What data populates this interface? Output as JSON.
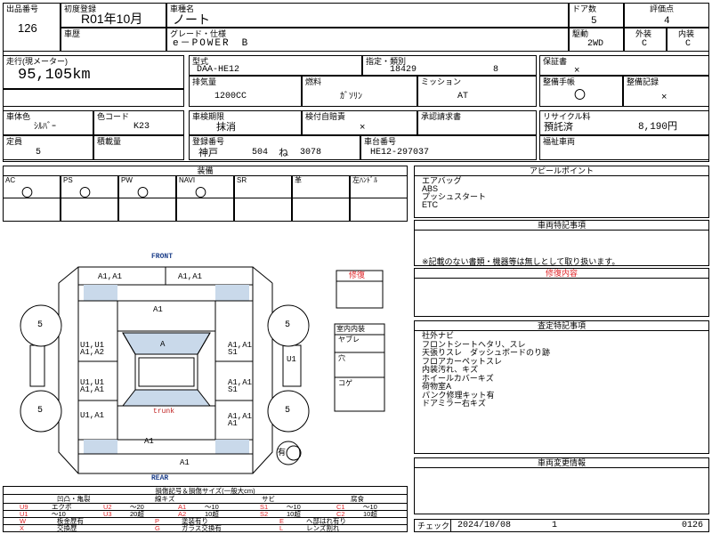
{
  "header": {
    "lot_label": "出品番号",
    "lot_value": "126",
    "first_reg_label": "初度登録",
    "first_reg_value": "R01年10月",
    "model_label": "車種名",
    "model_value": "ノート",
    "doors_label": "ドア数",
    "doors_value": "5",
    "score_label": "評価点",
    "score_value": "4",
    "history_label": "車歴",
    "grade_label": "グレード・仕様",
    "grade_value": "e－POWER　B",
    "drive_label": "駆動",
    "drive_value": "2WD",
    "exterior_label": "外装",
    "exterior_value": "C",
    "interior_label": "内装",
    "interior_value": "C",
    "mileage_label": "走行(現メーター)",
    "mileage_value": "95,105km",
    "type_label": "型式",
    "type_value": "DAA-HE12",
    "designation_label": "指定・類別",
    "designation_value1": "18429",
    "designation_value2": "8",
    "warranty_label": "保証書",
    "warranty_value": "×",
    "displacement_label": "排気量",
    "displacement_value": "1200CC",
    "fuel_label": "燃料",
    "fuel_value": "ｶﾞｿﾘﾝ",
    "mission_label": "ミッション",
    "mission_value": "AT",
    "manual_label": "整備手帳",
    "manual_value": "〇",
    "maint_label": "整備記録",
    "maint_value": "×",
    "color_label": "車体色",
    "color_value": "ｼﾙﾊﾞｰ",
    "colorcode_label": "色コード",
    "colorcode_value": "K23",
    "inspection_label": "車検期限",
    "inspection_value": "抹消",
    "recheck_label": "検付自賠責",
    "recheck_value": "×",
    "approval_label": "承認請求書",
    "recycle_label": "リサイクル料",
    "recycle_value1": "預託済",
    "recycle_value2": "8,190円",
    "capacity_label": "定員",
    "capacity_value": "5",
    "load_label": "積載量",
    "regno_label": "登録番号",
    "regno_value1": "神戸",
    "regno_value2": "504",
    "regno_value3": "ね",
    "regno_value4": "3078",
    "chassis_label": "車台番号",
    "chassis_value": "HE12-297037",
    "welfare_label": "福祉車両"
  },
  "equipment": {
    "title": "装備",
    "columns": [
      "AC",
      "PS",
      "PW",
      "NAVI",
      "SR",
      "革",
      "左ﾊﾝﾄﾞﾙ"
    ],
    "values": [
      "〇",
      "〇",
      "〇",
      "〇",
      "",
      "",
      ""
    ]
  },
  "appeal": {
    "title": "アピールポイント",
    "lines": [
      "エアバッグ",
      "ABS",
      "プッシュスタート",
      "ETC"
    ]
  },
  "vehicle_special": {
    "title": "車両特記事項",
    "note": "※記載のない書類・機器等は無しとして取り扱います。"
  },
  "repair": {
    "title": "修復内容"
  },
  "inspection_notes": {
    "title": "査定特記事項",
    "lines": [
      "社外ナビ",
      "フロントシートヘタリ、スレ",
      "天張りスレ　ダッシュボードのり跡",
      "フロアカーペットスレ",
      "内装汚れ、キズ",
      "ホイールカバーキズ",
      "荷物室A",
      "パンク修理キット有",
      "ドアミラー右キズ"
    ]
  },
  "change_info": {
    "title": "車両変更情報"
  },
  "check": {
    "label": "チェック",
    "date": "2024/10/08",
    "num": "1",
    "code": "0126"
  },
  "diagram": {
    "front": "FRONT",
    "rear": "REAR",
    "trunk": "trunk",
    "marks": [
      "A1,A1",
      "A1,A1",
      "A1",
      "A",
      "U1,U1\nA1,A2",
      "A1,A1\nS1",
      "U1,U1\nA1,A1",
      "A1,A1\nS1",
      "U1,A1",
      "A1,A1\nA1",
      "A1",
      "A1",
      "U1"
    ],
    "tires": [
      "5",
      "5",
      "5",
      "5"
    ],
    "spare_label": "有",
    "repair_box": "修復",
    "interior_box_title": "室内内装",
    "interior_items": [
      "ヤブレ",
      "穴",
      "コゲ"
    ]
  },
  "legend": {
    "title": "損傷記号＆損傷サイズ(一般大cm)",
    "headers": [
      "凹凸・亀裂",
      "線キズ",
      "サビ",
      "腐食"
    ],
    "row1": [
      "U9",
      "エクボ",
      "U2",
      "～20",
      "A1",
      "～10",
      "S1",
      "～10",
      "C1",
      "～10"
    ],
    "row2": [
      "U1",
      "～10",
      "U3",
      "20超",
      "A2",
      "10超",
      "S2",
      "10超",
      "C2",
      "10超"
    ],
    "row3": [
      "W",
      "板金歴有",
      "P",
      "塗装有り",
      "E",
      "ヘ部はれ有り"
    ],
    "row4": [
      "X",
      "交換歴",
      "G",
      "ガラス交換有",
      "L",
      "レンズ割れ"
    ]
  }
}
